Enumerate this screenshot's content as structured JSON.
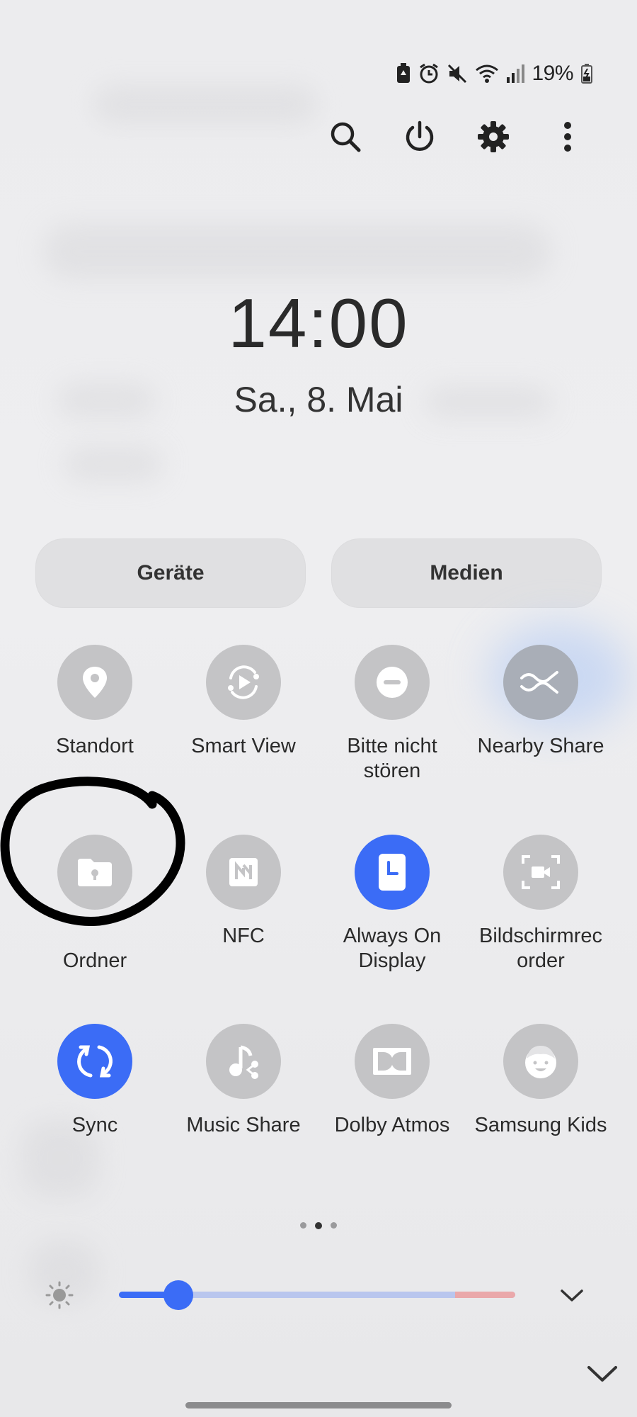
{
  "status_bar": {
    "battery_percent": "19%",
    "icons": [
      "battery-saver-icon",
      "alarm-icon",
      "mute-icon",
      "wifi-icon",
      "signal-icon",
      "battery-icon"
    ]
  },
  "top_actions": {
    "icons": [
      "search-icon",
      "power-icon",
      "settings-icon",
      "more-options-icon"
    ]
  },
  "clock": {
    "time": "14:00",
    "date": "Sa., 8. Mai"
  },
  "pills": {
    "devices": "Geräte",
    "media": "Medien"
  },
  "tiles": [
    {
      "label": "Standort",
      "icon": "location-pin-icon",
      "active": false
    },
    {
      "label": "Smart View",
      "icon": "smart-view-icon",
      "active": false
    },
    {
      "label": "Bitte nicht stören",
      "icon": "do-not-disturb-icon",
      "active": false
    },
    {
      "label": "Nearby Share",
      "icon": "nearby-share-icon",
      "active": false
    },
    {
      "label": "Ordner",
      "icon": "secure-folder-icon",
      "active": false
    },
    {
      "label": "NFC",
      "icon": "nfc-icon",
      "active": false
    },
    {
      "label": "Always On Display",
      "icon": "always-on-display-icon",
      "active": true
    },
    {
      "label": "Bildschirmrec order",
      "icon": "screen-recorder-icon",
      "active": false
    },
    {
      "label": "Sync",
      "icon": "sync-icon",
      "active": true
    },
    {
      "label": "Music Share",
      "icon": "music-share-icon",
      "active": false
    },
    {
      "label": "Dolby Atmos",
      "icon": "dolby-atmos-icon",
      "active": false
    },
    {
      "label": "Samsung Kids",
      "icon": "samsung-kids-icon",
      "active": false
    }
  ],
  "page_indicator": {
    "pages": 3,
    "current": 2
  },
  "brightness": {
    "level": 0.15,
    "icon": "brightness-icon"
  },
  "colors": {
    "accent": "#3b6cf6",
    "tile_off": "#c4c4c6",
    "brightness_track": "#b9c6ee",
    "brightness_high": "#eaa8aa"
  }
}
